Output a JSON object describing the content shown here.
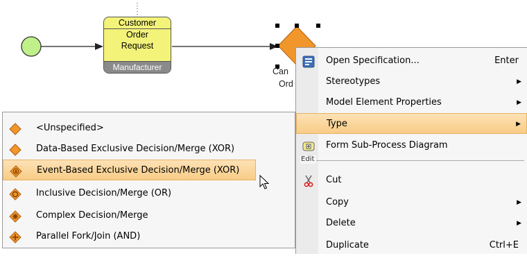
{
  "diagram": {
    "task": {
      "lines": [
        "Customer",
        "Order",
        "Request"
      ],
      "footer": "Manufacturer"
    },
    "gateway_label": [
      "Can",
      "Ord"
    ]
  },
  "type_submenu": {
    "items": [
      {
        "label": "<Unspecified>",
        "icon": "diamond-plain-icon"
      },
      {
        "label": "Data-Based Exclusive Decision/Merge (XOR)",
        "icon": "diamond-plain-icon"
      },
      {
        "label": "Event-Based Exclusive Decision/Merge (XOR)",
        "icon": "diamond-event-icon",
        "highlighted": true
      },
      {
        "label": "Inclusive Decision/Merge (OR)",
        "icon": "diamond-circle-icon"
      },
      {
        "label": "Complex Decision/Merge",
        "icon": "diamond-asterisk-icon"
      },
      {
        "label": "Parallel Fork/Join (AND)",
        "icon": "diamond-plus-icon"
      }
    ]
  },
  "context_menu": {
    "open_spec": {
      "label": "Open Specification...",
      "shortcut": "Enter",
      "icon": "specification-icon"
    },
    "stereotypes": {
      "label": "Stereotypes"
    },
    "model_props": {
      "label": "Model Element Properties"
    },
    "type": {
      "label": "Type"
    },
    "form_subprocess": {
      "label": "Form Sub-Process Diagram",
      "icon": "subprocess-icon"
    },
    "edit_section": "Edit",
    "cut": {
      "label": "Cut",
      "icon": "scissors-icon"
    },
    "copy": {
      "label": "Copy"
    },
    "delete": {
      "label": "Delete"
    },
    "duplicate": {
      "label": "Duplicate",
      "shortcut": "Ctrl+E"
    }
  },
  "colors": {
    "highlight": "#f8cc86",
    "gateway": "#f0962a",
    "task": "#f3f37a",
    "start_event": "#bff08a"
  }
}
